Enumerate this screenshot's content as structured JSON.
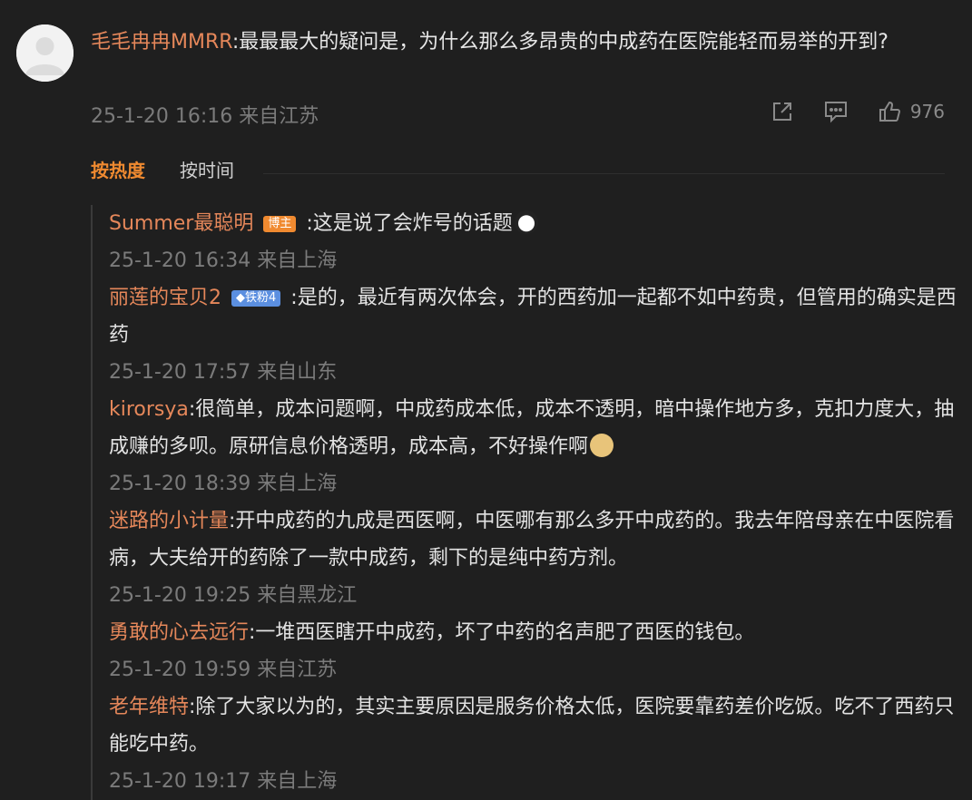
{
  "comment": {
    "author": "毛毛冉冉MMRR",
    "text": ":最最最大的疑问是，为什么那么多昂贵的中成药在医院能轻而易举的开到?",
    "time": "25-1-20 16:16",
    "location": "来自江苏",
    "likes": "976"
  },
  "tabs": {
    "hot": "按热度",
    "time": "按时间"
  },
  "replies": [
    {
      "author": "Summer最聪明",
      "badge": "博主",
      "badge_type": "boss",
      "text": ":这是说了会炸号的话题",
      "emoji": "panda-icon",
      "time": "25-1-20 16:34",
      "location": "来自上海"
    },
    {
      "author": "丽莲的宝贝2",
      "badge": "◆铁粉4",
      "badge_type": "fan",
      "text": ":是的，最近有两次体会，开的西药加一起都不如中药贵，但管用的确实是西药",
      "emoji": "",
      "time": "25-1-20 17:57",
      "location": "来自山东"
    },
    {
      "author": "kirorsya",
      "badge": "",
      "badge_type": "",
      "text": ":很简单，成本问题啊，中成药成本低，成本不透明，暗中操作地方多，克扣力度大，抽成赚的多呗。原研信息价格透明，成本高，不好操作啊",
      "emoji": "doge-icon",
      "time": "25-1-20 18:39",
      "location": "来自上海"
    },
    {
      "author": "迷路的小计量",
      "badge": "",
      "badge_type": "",
      "text": ":开中成药的九成是西医啊，中医哪有那么多开中成药的。我去年陪母亲在中医院看病，大夫给开的药除了一款中成药，剩下的是纯中药方剂。",
      "emoji": "",
      "time": "25-1-20 19:25",
      "location": "来自黑龙江"
    },
    {
      "author": "勇敢的心去远行",
      "badge": "",
      "badge_type": "",
      "text": ":一堆西医瞎开中成药，坏了中药的名声肥了西医的钱包。",
      "emoji": "",
      "time": "25-1-20 19:59",
      "location": "来自江苏"
    },
    {
      "author": "老年维特",
      "badge": "",
      "badge_type": "",
      "text": ":除了大家以为的，其实主要原因是服务价格太低，医院要靠药差价吃饭。吃不了西药只能吃中药。",
      "emoji": "",
      "time": "25-1-20 19:17",
      "location": "来自上海"
    }
  ]
}
